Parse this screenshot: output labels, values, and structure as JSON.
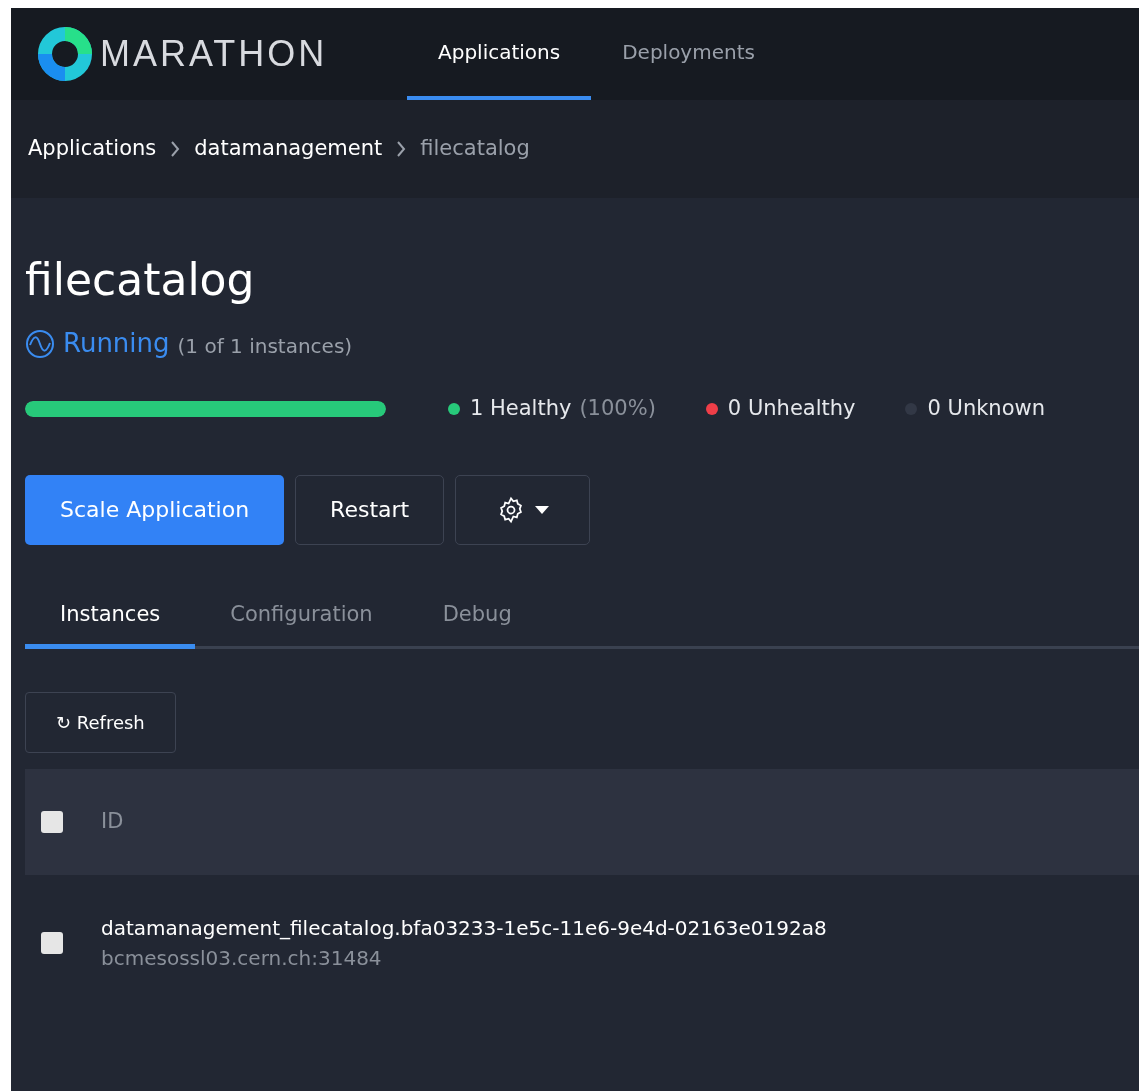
{
  "nav": {
    "brand": "MARATHON",
    "tabs": [
      {
        "label": "Applications",
        "selected": true
      },
      {
        "label": "Deployments",
        "selected": false
      }
    ]
  },
  "breadcrumb": [
    {
      "label": "Applications",
      "current": false
    },
    {
      "label": "datamanagement",
      "current": false
    },
    {
      "label": "filecatalog",
      "current": true
    }
  ],
  "app": {
    "title": "filecatalog",
    "status": "Running",
    "instances": "(1 of 1 instances)"
  },
  "health": {
    "level": 1,
    "legend": [
      {
        "count": "1 Healthy",
        "extra": "(100%)",
        "color": "#27c97a"
      },
      {
        "count": "0 Unhealthy",
        "color": "#ef3e48"
      },
      {
        "count": "0 Unknown",
        "color": "#323846"
      }
    ]
  },
  "actions": {
    "primary": "Scale Application",
    "secondary": "Restart"
  },
  "tabs": [
    {
      "label": "Instances",
      "selected": true
    },
    {
      "label": "Configuration",
      "selected": false
    },
    {
      "label": "Debug",
      "selected": false
    }
  ],
  "refresh": "↻ Refresh",
  "table": {
    "header": {
      "label": "ID",
      "checked": false
    },
    "rows": [
      {
        "id": "datamanagement_filecatalog.bfa03233-1e5c-11e6-9e4d-02163e0192a8",
        "host": "bcmesossl03.cern.ch:31484",
        "checked": false
      }
    ]
  }
}
